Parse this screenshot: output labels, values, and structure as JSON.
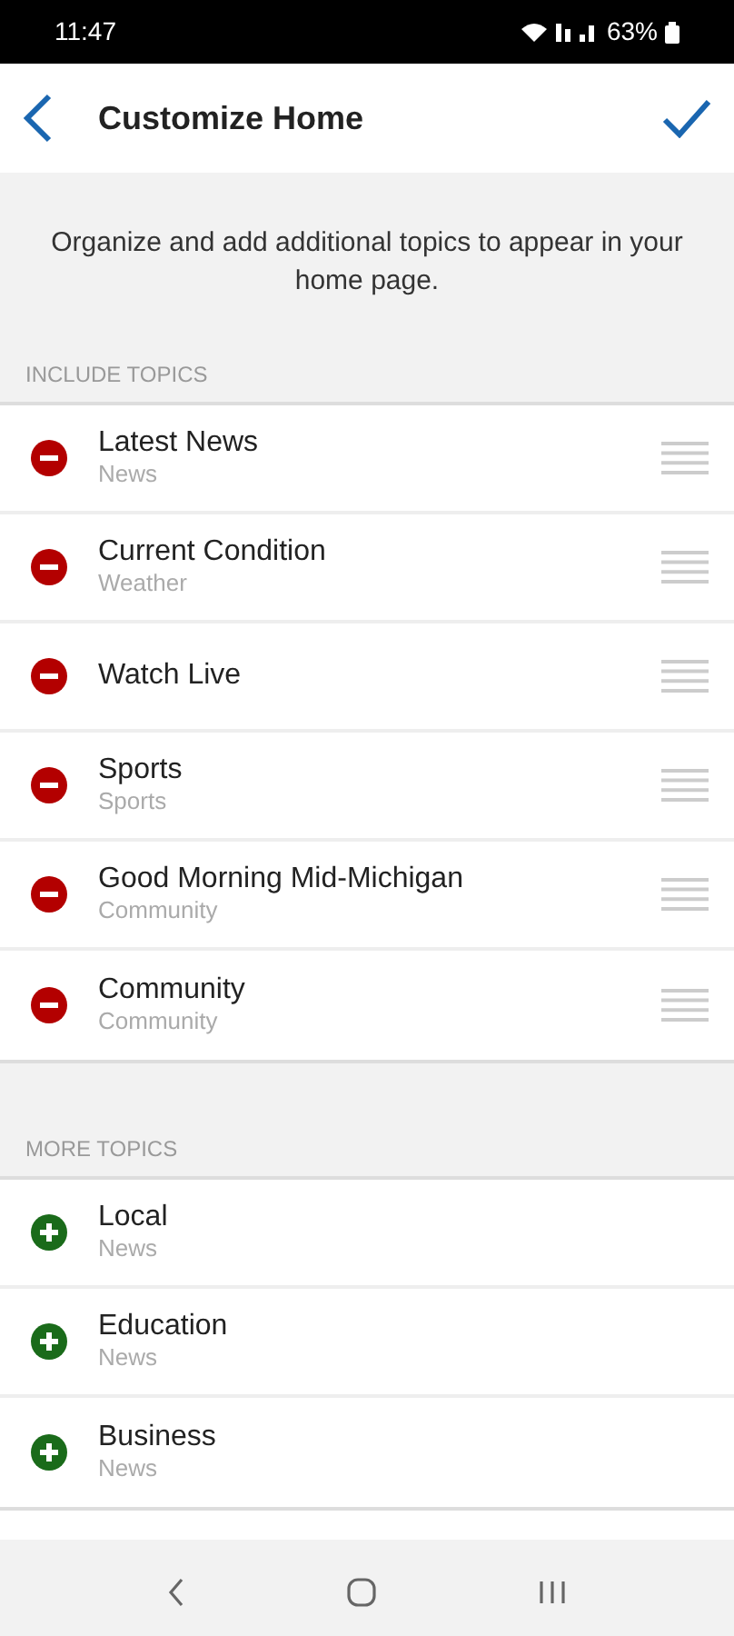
{
  "status_bar": {
    "time": "11:47",
    "battery": "63%"
  },
  "header": {
    "title": "Customize Home"
  },
  "description": "Organize and add additional topics to appear in your home page.",
  "sections": [
    {
      "heading": "INCLUDE TOPICS",
      "items": [
        {
          "name": "Latest News",
          "category": "News",
          "kind": "included"
        },
        {
          "name": "Current Condition",
          "category": "Weather",
          "kind": "included"
        },
        {
          "name": "Watch Live",
          "kind": "included"
        },
        {
          "name": "Sports",
          "category": "Sports",
          "kind": "included"
        },
        {
          "name": "Good Morning Mid-Michigan",
          "category": "Community",
          "kind": "included"
        },
        {
          "name": "Community",
          "category": "Community",
          "kind": "included"
        }
      ]
    },
    {
      "heading": "MORE TOPICS",
      "items": [
        {
          "name": "Local",
          "category": "News",
          "kind": "available"
        },
        {
          "name": "Education",
          "category": "News",
          "kind": "available"
        },
        {
          "name": "Business",
          "category": "News",
          "kind": "available"
        }
      ]
    }
  ]
}
